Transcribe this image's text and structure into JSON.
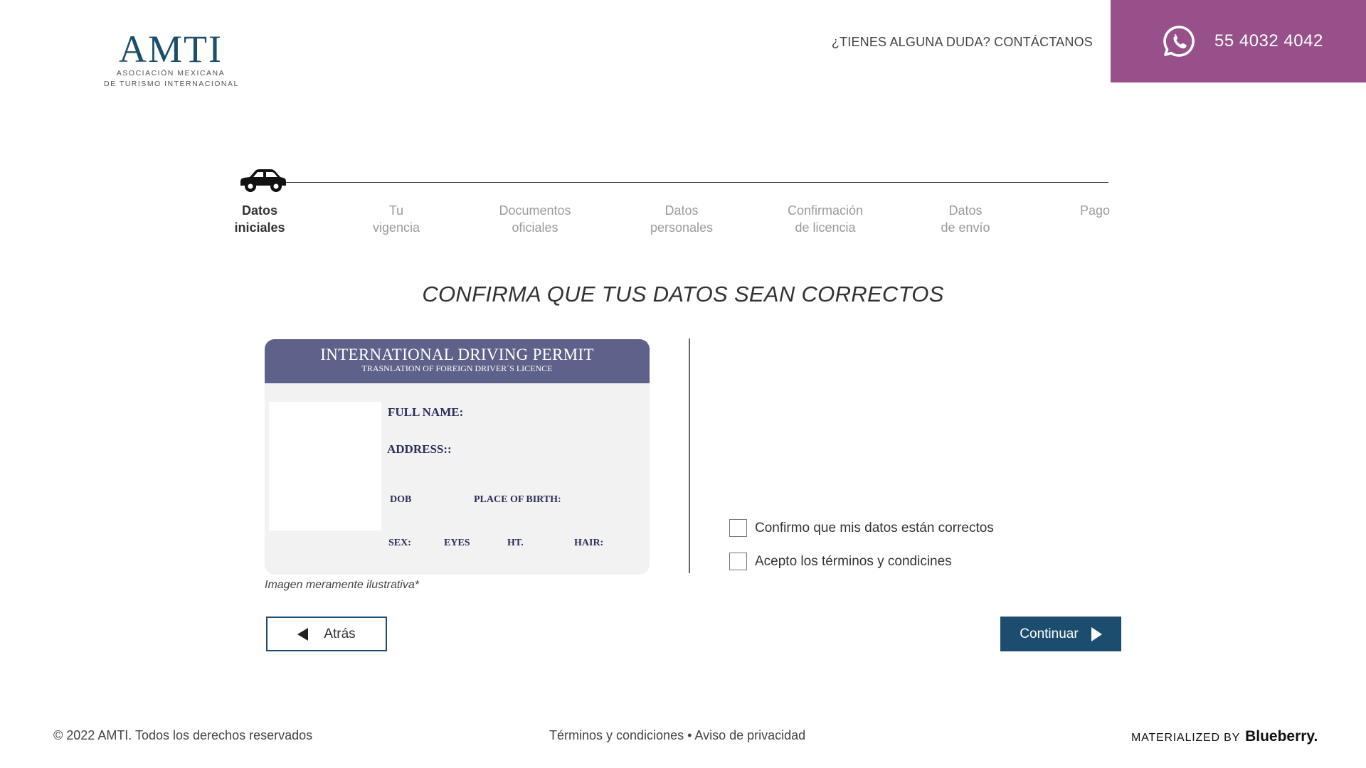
{
  "header": {
    "logo_text": "AMTI",
    "logo_subtitle_line1": "ASOCIACIÓN MEXICANA",
    "logo_subtitle_line2": "DE TURISMO INTERNACIONAL",
    "help_text": "¿TIENES ALGUNA DUDA? CONTÁCTANOS",
    "phone": "55 4032 4042",
    "phone_icon": "whatsapp-icon",
    "phone_bg_color": "#97508a"
  },
  "stepper": {
    "current_icon": "car-icon",
    "steps": [
      {
        "line1": "Datos",
        "line2": "iniciales",
        "active": true
      },
      {
        "line1": "Tu",
        "line2": "vigencia",
        "active": false
      },
      {
        "line1": "Documentos",
        "line2": "oficiales",
        "active": false
      },
      {
        "line1": "Datos",
        "line2": "personales",
        "active": false
      },
      {
        "line1": "Confirmación",
        "line2": "de licencia",
        "active": false
      },
      {
        "line1": "Datos",
        "line2": "de envío",
        "active": false
      },
      {
        "line1": "Pago",
        "line2": "",
        "active": false
      }
    ]
  },
  "main": {
    "title": "CONFIRMA QUE TUS DATOS SEAN CORRECTOS",
    "permit": {
      "title": "INTERNATIONAL DRIVING PERMIT",
      "subtitle": "TRASNLATION OF FOREIGN DRIVER´S LICENCE",
      "full_name_label": "FULL NAME:",
      "address_label": "ADDRESS::",
      "dob_label": "DOB",
      "place_of_birth_label": "PLACE OF BIRTH:",
      "sex_label": "SEX:",
      "eyes_label": "EYES",
      "height_label": "HT.",
      "hair_label": "HAIR:",
      "header_color": "#5e6189"
    },
    "disclaimer": "Imagen meramente ilustrativa*",
    "checkboxes": [
      {
        "label": "Confirmo que mis datos están correctos",
        "checked": false
      },
      {
        "label": "Acepto los términos y condicines",
        "checked": false
      }
    ],
    "back_label": "Atrás",
    "continue_label": "Continuar",
    "accent_color": "#1c4d6e"
  },
  "footer": {
    "copyright": "© 2022 AMTI. Todos los derechos reservados",
    "terms_link": "Términos y condiciones",
    "separator": " • ",
    "privacy_link": "Aviso de privacidad",
    "credit_label": "MATERIALIZED BY",
    "credit_brand": "Blueberry."
  }
}
